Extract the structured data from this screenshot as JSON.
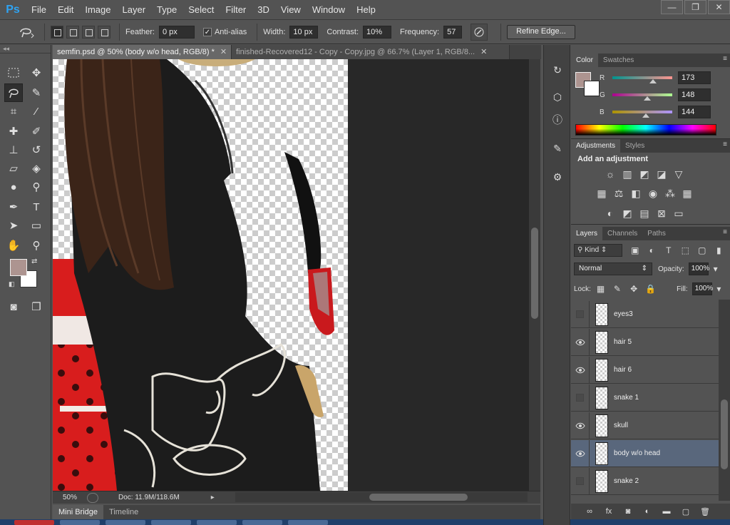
{
  "app": {
    "logo": "Ps"
  },
  "menu": [
    "File",
    "Edit",
    "Image",
    "Layer",
    "Type",
    "Select",
    "Filter",
    "3D",
    "View",
    "Window",
    "Help"
  ],
  "window_controls": {
    "minimize": "—",
    "restore": "❐",
    "close": "✕"
  },
  "options": {
    "feather_label": "Feather:",
    "feather_value": "0 px",
    "antialias_label": "Anti-alias",
    "antialias_checked": true,
    "width_label": "Width:",
    "width_value": "10 px",
    "contrast_label": "Contrast:",
    "contrast_value": "10%",
    "frequency_label": "Frequency:",
    "frequency_value": "57",
    "refine_edge": "Refine Edge..."
  },
  "doc_tabs": [
    {
      "label": "semfin.psd @ 50% (body w/o head, RGB/8) *",
      "active": true
    },
    {
      "label": "finished-Recovered12 - Copy - Copy.jpg @ 66.7% (Layer 1, RGB/8...",
      "active": false
    }
  ],
  "tab_close": "✕",
  "status": {
    "zoom": "50%",
    "doc": "Doc: 11.9M/118.6M"
  },
  "bottom_tabs": [
    "Mini Bridge",
    "Timeline"
  ],
  "color_panel": {
    "tabs": [
      "Color",
      "Swatches"
    ],
    "foreground": "#ad9490",
    "background": "#ffffff",
    "channels": [
      {
        "label": "R",
        "value": "173",
        "fraction": 0.68
      },
      {
        "label": "G",
        "value": "148",
        "fraction": 0.58
      },
      {
        "label": "B",
        "value": "144",
        "fraction": 0.56
      }
    ]
  },
  "adjustments": {
    "tabs": [
      "Adjustments",
      "Styles"
    ],
    "title": "Add an adjustment"
  },
  "layers_panel": {
    "tabs": [
      "Layers",
      "Channels",
      "Paths"
    ],
    "kind": "Kind",
    "blend_mode": "Normal",
    "opacity_label": "Opacity:",
    "opacity_value": "100%",
    "lock_label": "Lock:",
    "fill_label": "Fill:",
    "fill_value": "100%",
    "layers": [
      {
        "name": "eyes3",
        "visible": false,
        "selected": false
      },
      {
        "name": "hair 5",
        "visible": true,
        "selected": false
      },
      {
        "name": "hair 6",
        "visible": true,
        "selected": false
      },
      {
        "name": "snake 1",
        "visible": false,
        "selected": false
      },
      {
        "name": "skull",
        "visible": true,
        "selected": false
      },
      {
        "name": "body w/o head",
        "visible": true,
        "selected": true
      },
      {
        "name": "snake 2",
        "visible": false,
        "selected": false
      }
    ]
  }
}
